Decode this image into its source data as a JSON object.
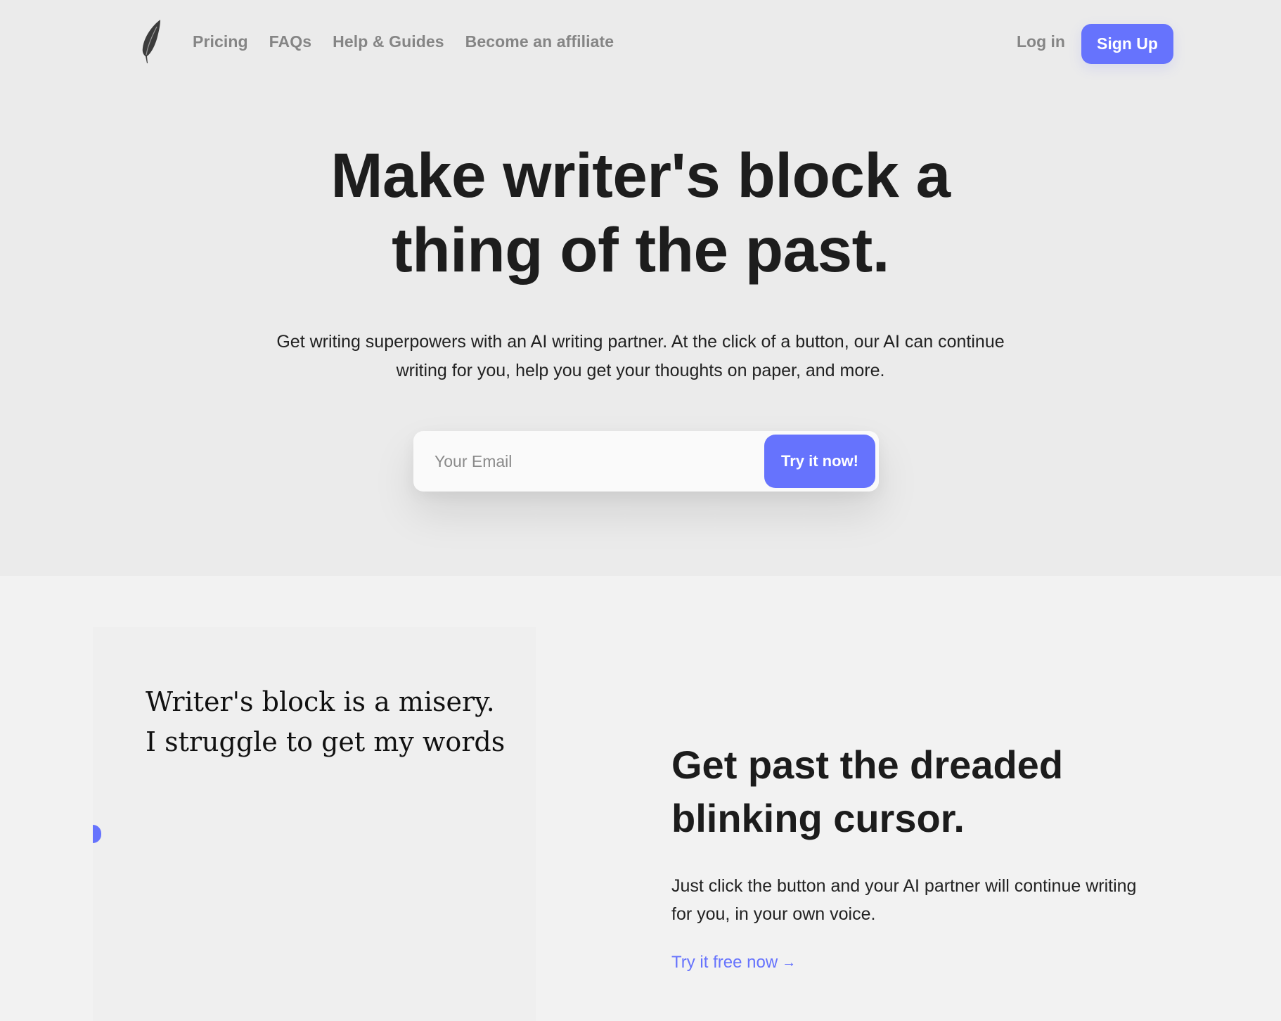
{
  "nav": {
    "logo_icon": "feather-icon",
    "links": [
      {
        "label": "Pricing"
      },
      {
        "label": "FAQs"
      },
      {
        "label": "Help & Guides"
      },
      {
        "label": "Become an affiliate"
      }
    ],
    "login_label": "Log in",
    "signup_label": "Sign Up"
  },
  "hero": {
    "headline_line1": "Make writer's block a",
    "headline_line2": "thing of the past.",
    "subtext_line1": "Get writing superpowers with an AI writing partner. At the click of a button, our AI can continue",
    "subtext_line2": "writing for you, help you get your thoughts on paper, and more.",
    "email_placeholder": "Your Email",
    "email_value": "",
    "cta_label": "Try it now!"
  },
  "feature": {
    "demo_lines": [
      "Writer's block is a misery.",
      "I struggle to get my words"
    ],
    "title_line1": "Get past the dreaded",
    "title_line2": "blinking cursor.",
    "desc_line1": "Just click the button and your AI partner will continue writing",
    "desc_line2": "for you, in your own voice.",
    "link_label": "Try it free now",
    "link_arrow": "→"
  },
  "colors": {
    "accent": "#6673fd",
    "hero_bg": "#ebebeb",
    "section_bg": "#f2f2f2",
    "nav_text": "#858585",
    "heading_text": "#1c1c1c"
  }
}
